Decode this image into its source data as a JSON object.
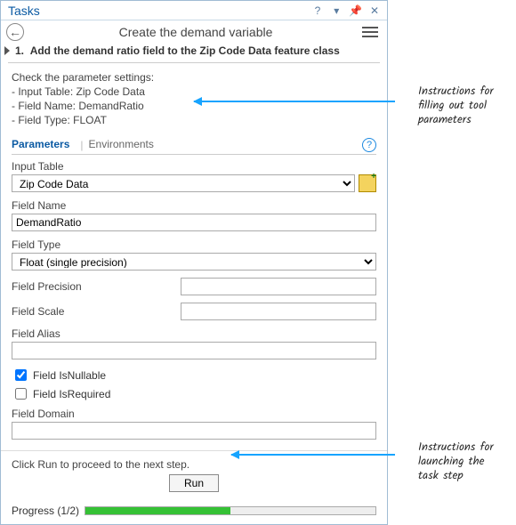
{
  "titlebar": {
    "title": "Tasks"
  },
  "subheader": {
    "title": "Create the demand variable"
  },
  "step": {
    "number": "1.",
    "text": "Add the demand ratio field to the Zip Code Data feature class"
  },
  "instructions": {
    "heading": "Check the parameter settings:",
    "lines": [
      "- Input Table: Zip Code Data",
      "- Field Name: DemandRatio",
      "- Field Type: FLOAT"
    ]
  },
  "tabs": {
    "active": "Parameters",
    "other": "Environments"
  },
  "form": {
    "input_table": {
      "label": "Input Table",
      "value": "Zip Code Data"
    },
    "field_name": {
      "label": "Field Name",
      "value": "DemandRatio"
    },
    "field_type": {
      "label": "Field Type",
      "value": "Float (single precision)"
    },
    "field_precision": {
      "label": "Field Precision",
      "value": ""
    },
    "field_scale": {
      "label": "Field Scale",
      "value": ""
    },
    "field_alias": {
      "label": "Field Alias",
      "value": ""
    },
    "is_nullable": {
      "label": "Field IsNullable",
      "checked": true
    },
    "is_required": {
      "label": "Field IsRequired",
      "checked": false
    },
    "field_domain": {
      "label": "Field Domain",
      "value": ""
    }
  },
  "footer": {
    "hint": "Click Run to proceed to the next step.",
    "run_label": "Run"
  },
  "progress": {
    "label": "Progress (1/2)",
    "percent": 50
  },
  "annotations": {
    "top": "Instructions for filling out tool parameters",
    "bottom": "Instructions for launching the task step"
  }
}
